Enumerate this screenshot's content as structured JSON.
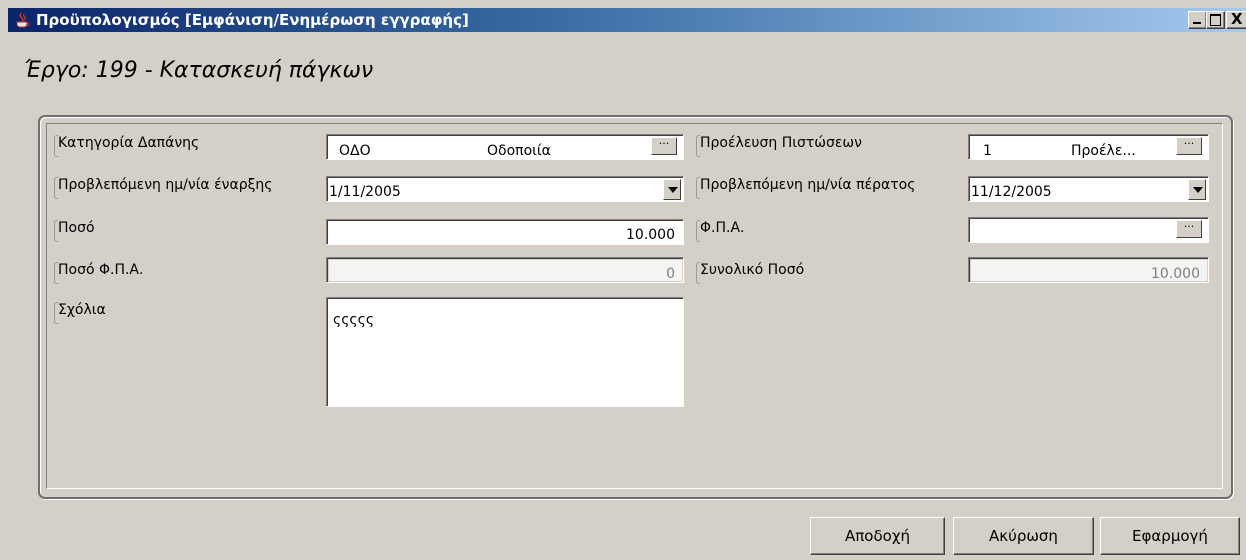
{
  "window": {
    "title": "Προϋπολογισμός [Εμφάνιση/Ενημέρωση  εγγραφής]",
    "controls": {
      "minimize": "_",
      "maximize": "□",
      "close": "X"
    }
  },
  "heading": "Έργο: 199 - Κατασκευή πάγκων",
  "form": {
    "expense_category": {
      "label": "Κατηγορία Δαπάνης",
      "code": "ΟΔΟ",
      "name": "Οδοποιία",
      "browse": "···"
    },
    "planned_start": {
      "label": "Προβλεπόμενη ημ/νία έναρξης",
      "value": "1/11/2005"
    },
    "amount": {
      "label": "Ποσό",
      "value": "10.000"
    },
    "vat_amount": {
      "label": "Ποσό Φ.Π.Α.",
      "value": "0"
    },
    "comments": {
      "label": "Σχόλια",
      "value": "ςςςςς"
    },
    "credit_source": {
      "label": "Προέλευση Πιστώσεων",
      "code": "1",
      "name": "Προέλε...",
      "browse": "···"
    },
    "planned_end": {
      "label": "Προβλεπόμενη ημ/νία πέρατος",
      "value": "11/12/2005"
    },
    "vat": {
      "label": "Φ.Π.Α.",
      "value": "",
      "browse": "···"
    },
    "total_amount": {
      "label": "Συνολικό Ποσό",
      "value": "10.000"
    }
  },
  "buttons": {
    "accept": "Αποδοχή",
    "cancel": "Ακύρωση",
    "apply": "Εφαρμογή"
  },
  "colors": {
    "titlebar_start": "#0a246a",
    "titlebar_end": "#a6caf0",
    "window_bg": "#d4d0c8"
  }
}
